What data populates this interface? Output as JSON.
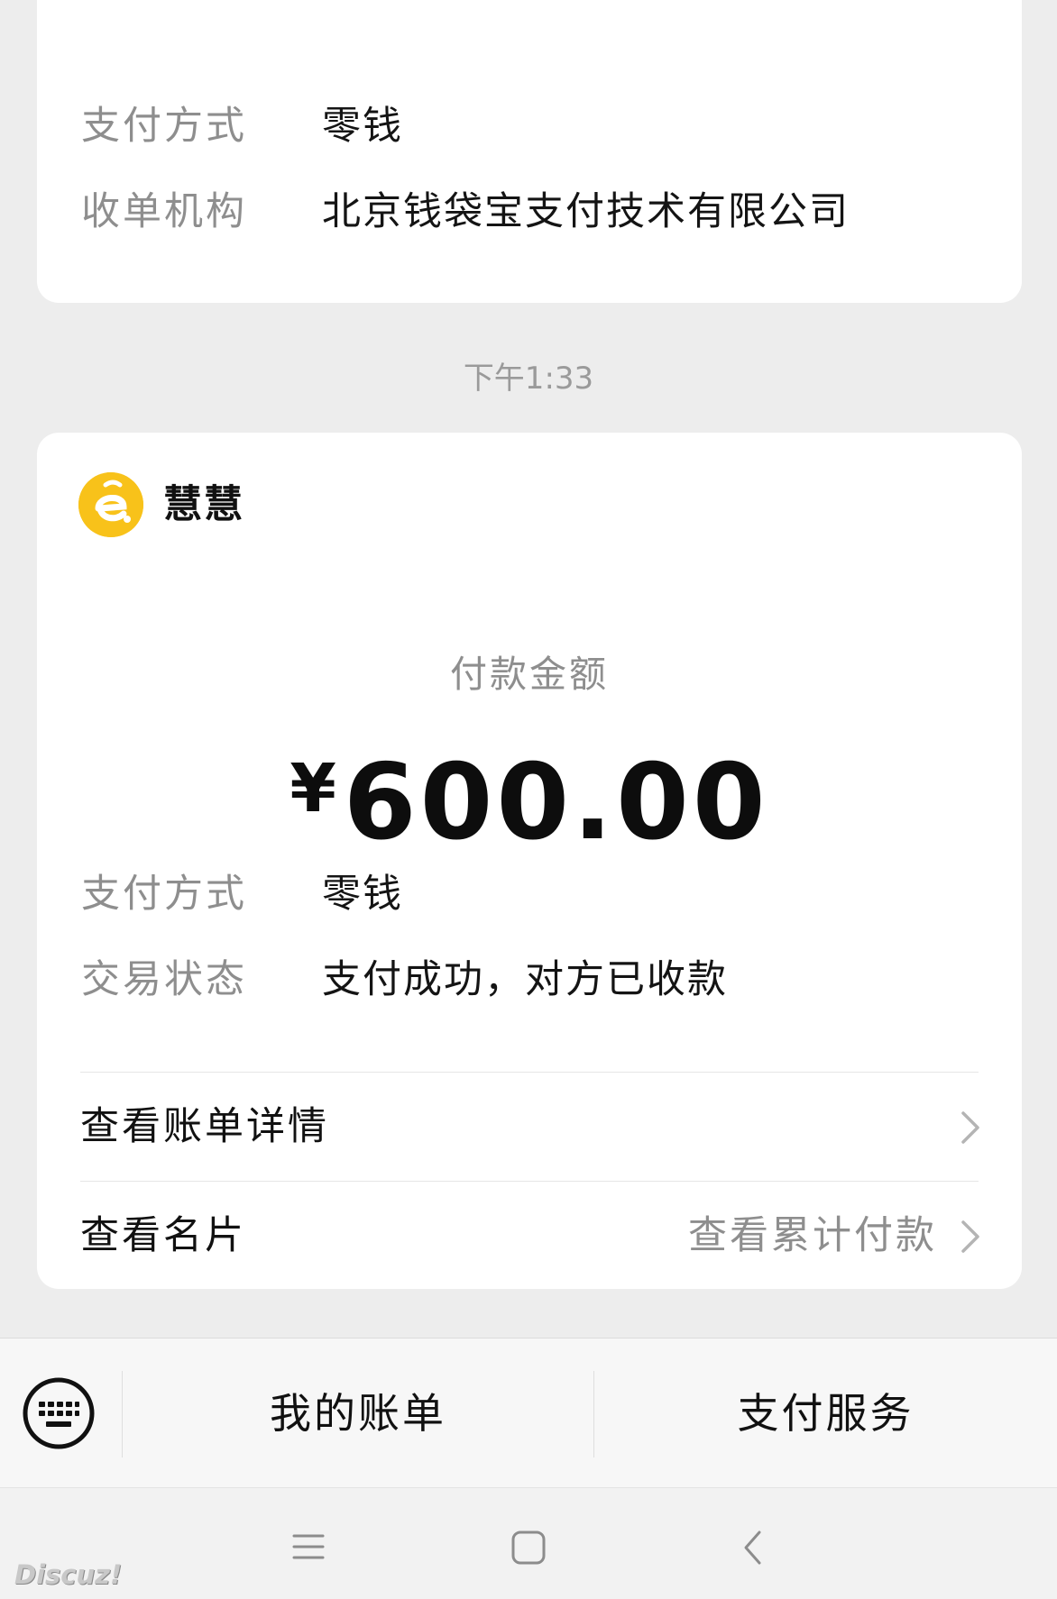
{
  "top_card": {
    "rows": [
      {
        "label": "支付方式",
        "value": "零钱"
      },
      {
        "label": "收单机构",
        "value": "北京钱袋宝支付技术有限公司"
      }
    ]
  },
  "timestamp": "下午1:33",
  "main_card": {
    "merchant_name": "慧慧",
    "amount_label": "付款金额",
    "currency_symbol": "¥",
    "amount": "600.00",
    "rows": [
      {
        "label": "支付方式",
        "value": "零钱"
      },
      {
        "label": "交易状态",
        "value": "支付成功，对方已收款"
      }
    ],
    "links": [
      {
        "label": "查看账单详情",
        "hint": ""
      },
      {
        "label": "查看名片",
        "hint": "查看累计付款"
      }
    ]
  },
  "bottom_bar": {
    "menu": [
      "我的账单",
      "支付服务"
    ]
  },
  "watermark": "Discuz!",
  "colors": {
    "background": "#ededed",
    "card": "#ffffff",
    "avatar": "#f8c21a"
  },
  "icons": [
    "keyboard-icon",
    "chevron-right-icon",
    "nav-menu-icon",
    "nav-home-icon",
    "nav-back-icon"
  ]
}
